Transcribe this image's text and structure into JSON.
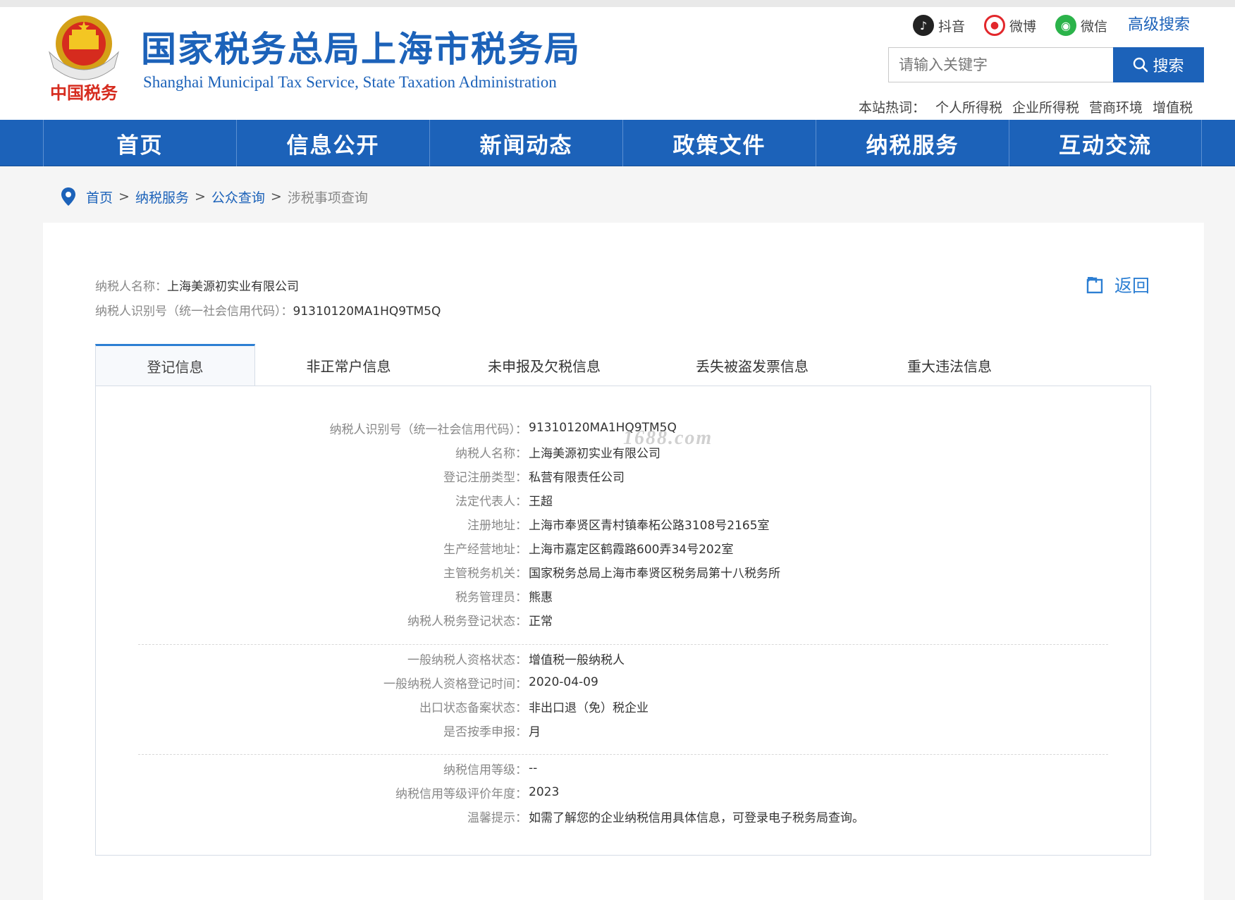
{
  "header": {
    "title": "国家税务总局上海市税务局",
    "subtitle": "Shanghai Municipal Tax Service, State Taxation Administration",
    "emblem_caption": "中国税务",
    "social": [
      {
        "label": "抖音",
        "icon": "douyin-icon"
      },
      {
        "label": "微博",
        "icon": "weibo-icon"
      },
      {
        "label": "微信",
        "icon": "wechat-icon"
      }
    ],
    "advanced_search": "高级搜索",
    "search": {
      "placeholder": "请输入关键字",
      "button": "搜索"
    },
    "hot_label": "本站热词：",
    "hot_words": [
      "个人所得税",
      "企业所得税",
      "营商环境",
      "增值税"
    ]
  },
  "nav": [
    "首页",
    "信息公开",
    "新闻动态",
    "政策文件",
    "纳税服务",
    "互动交流"
  ],
  "breadcrumb": {
    "links": [
      "首页",
      "纳税服务",
      "公众查询"
    ],
    "separator": ">",
    "current": "涉税事项查询"
  },
  "taxpayer": {
    "name_label": "纳税人名称：",
    "name": "上海美源初实业有限公司",
    "id_label": "纳税人识别号（统一社会信用代码）：",
    "id": "91310120MA1HQ9TM5Q"
  },
  "back_label": "返回",
  "tabs": [
    "登记信息",
    "非正常户信息",
    "未申报及欠税信息",
    "丢失被盗发票信息",
    "重大违法信息"
  ],
  "active_tab": 0,
  "watermark": "1688.com",
  "details": {
    "group1": [
      {
        "label": "纳税人识别号（统一社会信用代码）：",
        "value": "91310120MA1HQ9TM5Q"
      },
      {
        "label": "纳税人名称：",
        "value": "上海美源初实业有限公司"
      },
      {
        "label": "登记注册类型：",
        "value": "私营有限责任公司"
      },
      {
        "label": "法定代表人：",
        "value": "王超"
      },
      {
        "label": "注册地址：",
        "value": "上海市奉贤区青村镇奉柘公路3108号2165室"
      },
      {
        "label": "生产经营地址：",
        "value": "上海市嘉定区鹤霞路600弄34号202室"
      },
      {
        "label": "主管税务机关：",
        "value": "国家税务总局上海市奉贤区税务局第十八税务所"
      },
      {
        "label": "税务管理员：",
        "value": "熊惠"
      },
      {
        "label": "纳税人税务登记状态：",
        "value": "正常"
      }
    ],
    "group2": [
      {
        "label": "一般纳税人资格状态：",
        "value": "增值税一般纳税人"
      },
      {
        "label": "一般纳税人资格登记时间：",
        "value": "2020-04-09"
      },
      {
        "label": "出口状态备案状态：",
        "value": "非出口退（免）税企业"
      },
      {
        "label": "是否按季申报：",
        "value": "月"
      }
    ],
    "group3": [
      {
        "label": "纳税信用等级：",
        "value": "--"
      },
      {
        "label": "纳税信用等级评价年度：",
        "value": "2023"
      },
      {
        "label": "温馨提示：",
        "value": "如需了解您的企业纳税信用具体信息，可登录电子税务局查询。"
      }
    ]
  },
  "colors": {
    "brand_blue": "#1c62b9",
    "link_blue": "#2d7fd3"
  }
}
